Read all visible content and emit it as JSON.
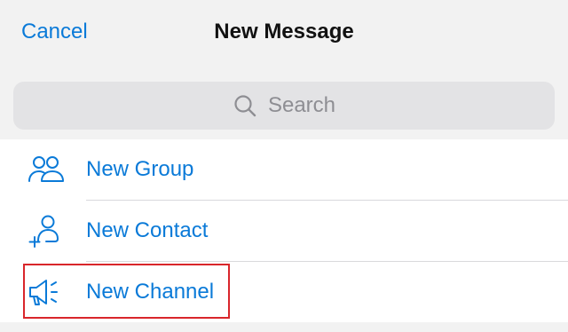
{
  "header": {
    "cancel_label": "Cancel",
    "title": "New Message"
  },
  "search": {
    "placeholder": "Search",
    "icon": "search-icon"
  },
  "menu": {
    "items": [
      {
        "label": "New Group",
        "icon": "group-icon"
      },
      {
        "label": "New Contact",
        "icon": "add-contact-icon"
      },
      {
        "label": "New Channel",
        "icon": "megaphone-icon",
        "highlighted": true
      }
    ]
  },
  "colors": {
    "accent": "#0a7ad8",
    "background": "#f2f2f2",
    "highlight_border": "#d9262b"
  }
}
